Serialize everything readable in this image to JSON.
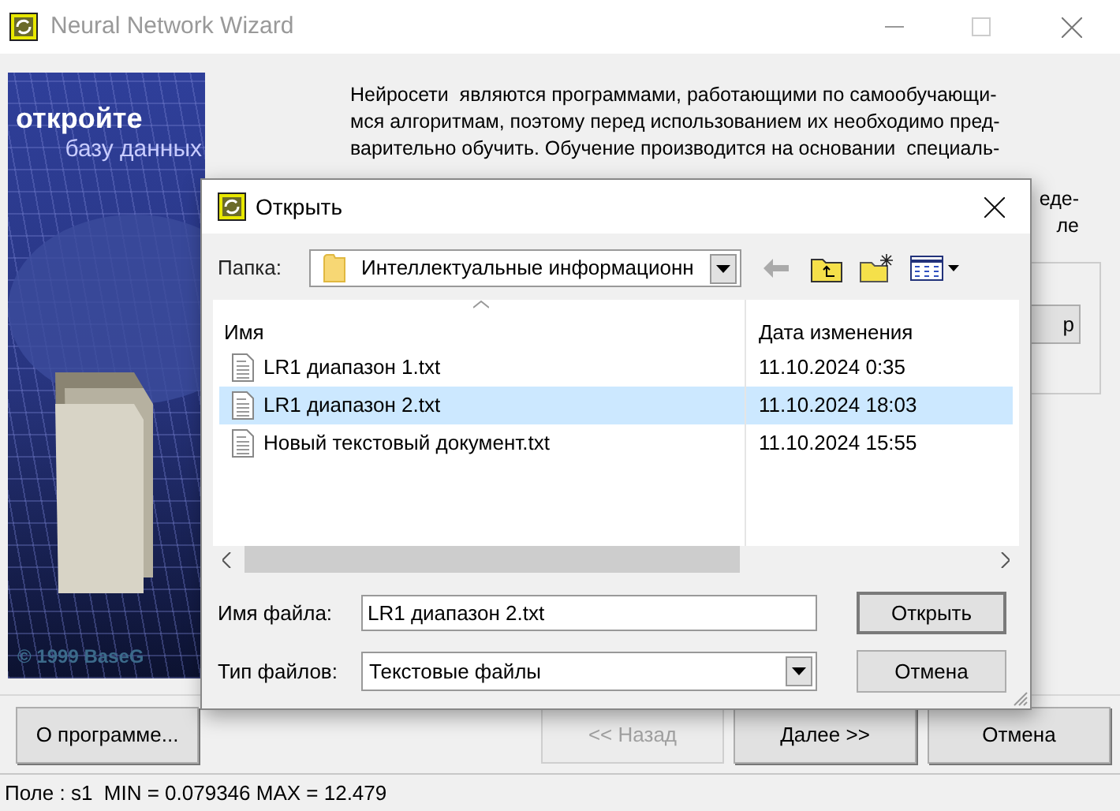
{
  "window": {
    "title": "Neural Network Wizard"
  },
  "banner": {
    "heading": "откройте",
    "subheading": "базу данных",
    "copyright": "© 1999 BaseG"
  },
  "intro_lines": [
    "Нейросети  являются программами, работающими по самообучающи-",
    "мся алгоритмам, поэтому перед использованием их необходимо пред-",
    "варительно обучить. Обучение производится на основании  специаль-"
  ],
  "intro_fragments": [
    "еде-",
    "ле"
  ],
  "group_button": {
    "label": "р"
  },
  "buttons": [
    {
      "label": "О программе...",
      "disabled": false
    },
    {
      "label": "<< Назад",
      "disabled": true
    },
    {
      "label": "Далее >>",
      "disabled": false
    },
    {
      "label": "Отмена",
      "disabled": false
    }
  ],
  "status_bar": "Поле : s1  MIN = 0.079346 MAX = 12.479",
  "dialog": {
    "title": "Открыть",
    "folder_label": "Папка:",
    "folder_value": "Интеллектуальные информационн",
    "columns": [
      "Имя",
      "Дата изменения"
    ],
    "files": [
      {
        "name": "LR1 диапазон 1.txt",
        "date": "11.10.2024 0:35",
        "selected": false
      },
      {
        "name": "LR1 диапазон 2.txt",
        "date": "11.10.2024 18:03",
        "selected": true
      },
      {
        "name": "Новый текстовый документ.txt",
        "date": "11.10.2024 15:55",
        "selected": false
      }
    ],
    "filename_label": "Имя файла:",
    "filename_value": "LR1 диапазон 2.txt",
    "filetype_label": "Тип файлов:",
    "filetype_value": "Текстовые файлы",
    "buttons": [
      "Открыть",
      "Отмена"
    ]
  }
}
